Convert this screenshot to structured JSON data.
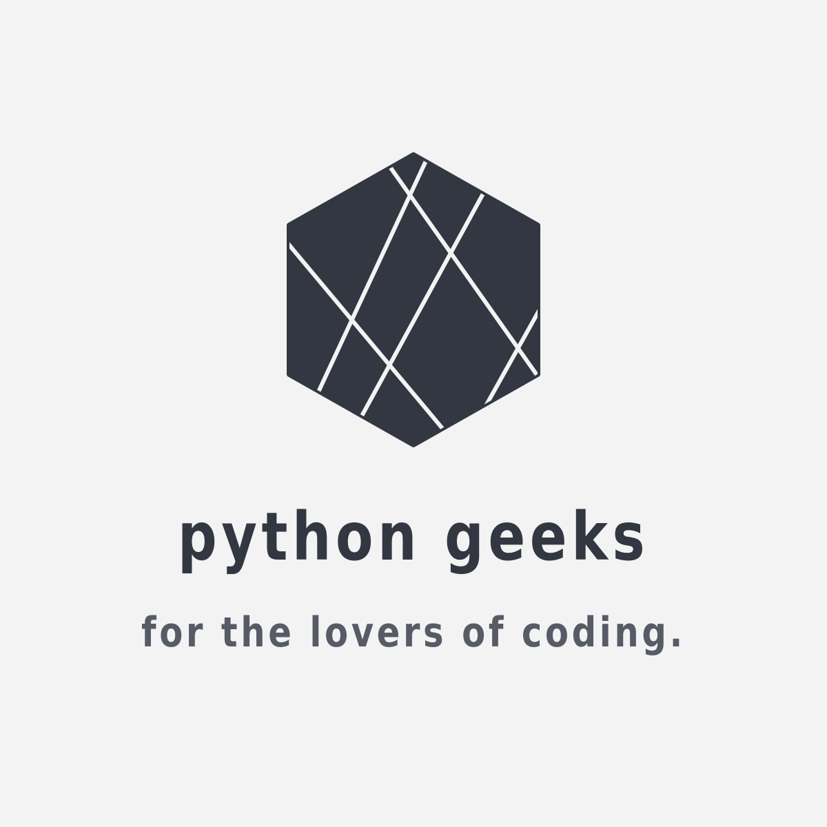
{
  "brand": {
    "name": "python geeks",
    "tagline": "for the lovers of coding."
  },
  "logo": {
    "icon": "faceted-hexagon-icon"
  },
  "colors": {
    "background": "#f3f3f3",
    "primary": "#323741",
    "secondary": "#565b65",
    "facet_lines": "#f3f3f3"
  }
}
